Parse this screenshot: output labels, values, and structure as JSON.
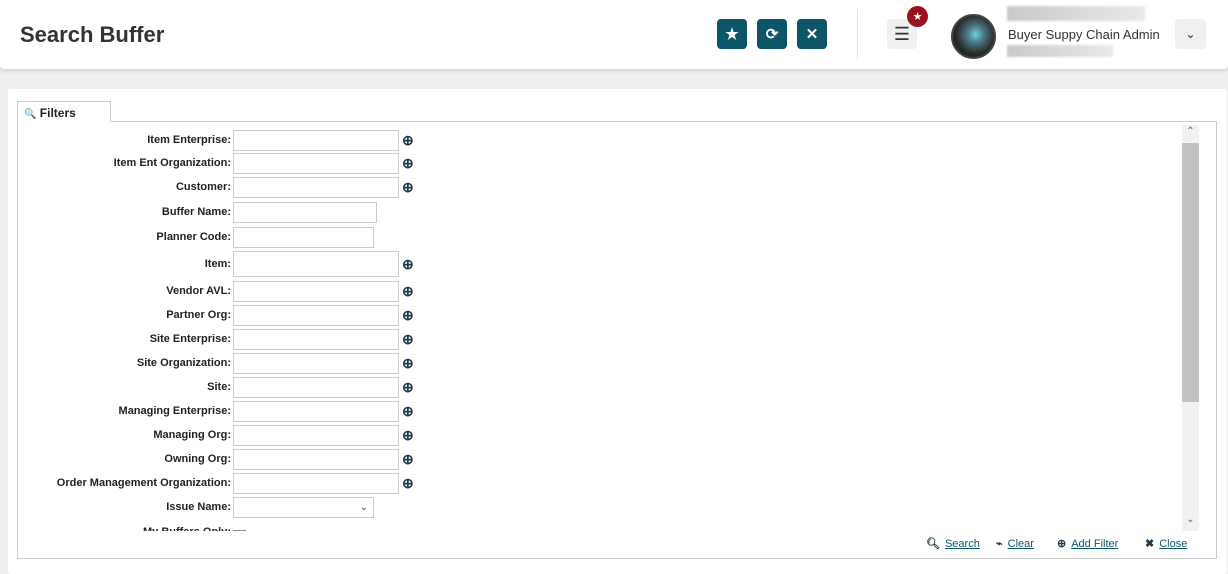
{
  "header": {
    "title": "Search Buffer",
    "user_role": "Buyer Suppy Chain Admin",
    "buttons": [
      {
        "name": "favorite",
        "icon": "star-icon",
        "glyph": "★"
      },
      {
        "name": "refresh",
        "icon": "refresh-icon",
        "glyph": "⟳"
      },
      {
        "name": "close",
        "icon": "close-icon",
        "glyph": "✕"
      }
    ],
    "menu_glyph": "☰",
    "badge_glyph": "★",
    "dropdown_glyph": "⌄",
    "accent": "#0d5668",
    "badge_color": "#9b111e"
  },
  "filters": {
    "tab_label": "Filters",
    "tab_icon": "🔍",
    "fields": [
      {
        "label": "Item Enterprise:",
        "type": "lookup",
        "value": ""
      },
      {
        "label": "Item Ent Organization:",
        "type": "lookup",
        "value": ""
      },
      {
        "label": "Customer:",
        "type": "lookup",
        "value": ""
      },
      {
        "label": "Buffer Name:",
        "type": "text",
        "value": ""
      },
      {
        "label": "Planner Code:",
        "type": "text",
        "value": ""
      },
      {
        "label": "Item:",
        "type": "lookup",
        "value": ""
      },
      {
        "label": "Vendor AVL:",
        "type": "lookup",
        "value": ""
      },
      {
        "label": "Partner Org:",
        "type": "lookup",
        "value": ""
      },
      {
        "label": "Site Enterprise:",
        "type": "lookup",
        "value": ""
      },
      {
        "label": "Site Organization:",
        "type": "lookup",
        "value": ""
      },
      {
        "label": "Site:",
        "type": "lookup",
        "value": ""
      },
      {
        "label": "Managing Enterprise:",
        "type": "lookup",
        "value": ""
      },
      {
        "label": "Managing Org:",
        "type": "lookup",
        "value": ""
      },
      {
        "label": "Owning Org:",
        "type": "lookup",
        "value": ""
      },
      {
        "label": "Order Management Organization:",
        "type": "lookup",
        "value": ""
      },
      {
        "label": "Issue Name:",
        "type": "select",
        "value": ""
      },
      {
        "label": "My Buffers Only:",
        "type": "checkbox",
        "checked": false
      }
    ]
  },
  "actions": {
    "search": "Search",
    "clear": "Clear",
    "add_filter": "Add Filter",
    "close": "Close"
  }
}
